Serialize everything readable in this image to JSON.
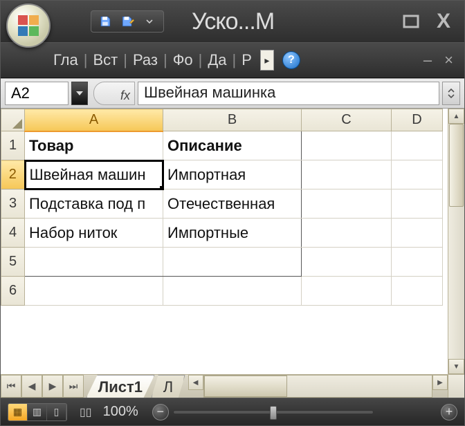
{
  "title": "Уско...М",
  "ribbon": {
    "tabs": [
      "Гла",
      "Вст",
      "Раз",
      "Фо",
      "Да",
      "Р"
    ]
  },
  "help_icon": "?",
  "namebox": "A2",
  "fx_label": "fx",
  "formula_value": "Швейная машинка",
  "columns": [
    "A",
    "B",
    "C",
    "D"
  ],
  "rows": [
    "1",
    "2",
    "3",
    "4",
    "5",
    "6"
  ],
  "cells": {
    "A1": "Товар",
    "B1": "Описание",
    "A2": "Швейная машин",
    "B2": "Импортная",
    "A3": "Подставка под п",
    "B3": "Отечественная",
    "A4": "Набор ниток",
    "B4": "Импортные"
  },
  "sheet_tabs": {
    "active": "Лист1",
    "next": "Л"
  },
  "zoom": "100%"
}
